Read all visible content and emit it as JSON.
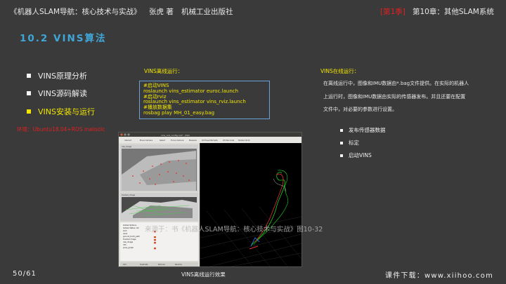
{
  "header": {
    "book_title": "《机器人SLAM导航：核心技术与实战》",
    "author": "张虎 著",
    "publisher": "机械工业出版社",
    "chapter_tag": "[第1季]",
    "chapter_title": "第10章：其他SLAM系统"
  },
  "section_title": "10.2 VINS算法",
  "left_list": [
    {
      "label": "VINS原理分析",
      "active": false
    },
    {
      "label": "VINS源码解读",
      "active": false
    },
    {
      "label": "VINS安装与运行",
      "active": true
    }
  ],
  "env_note": "环境：Ubuntu18.04+ROS melodic",
  "offline": {
    "title": "VINS离线运行：",
    "code_lines": [
      "#启动VINS",
      "roslaunch vins_estimator euroc.launch",
      "#启动rviz",
      "roslaunch vins_estimator vins_rviz.launch",
      "#播放数据集",
      "rosbag play MH_01_easy.bag"
    ],
    "caption": "VINS离线运行效果"
  },
  "online": {
    "title": "VINS在线运行：",
    "description": [
      "在离线运行中，图像和IMU数据由*.bag文件提供。在实际的机器人",
      "上运行时，图像和IMU数据由实际的传感器发布。并且还要在配置",
      "文件中，对必要的参数进行设置。"
    ],
    "items": [
      "发布传感器数据",
      "标定",
      "启动VINS"
    ]
  },
  "screenshot": {
    "window_title": "vins_rviz_config.rviz* - RViz",
    "toolbar": [
      "Interact",
      "Move Camera",
      "Select",
      "Focus Camera",
      "Measure",
      "2D Pose Estimate",
      "2D Nav Goal",
      "Publish Point"
    ],
    "image_panel_title": "raw_image",
    "match_panel_title": "tracked_image",
    "tree_items": [
      "Global Options",
      "Global Status: Ok",
      "Grid",
      "Axes",
      "ground_truth_path",
      "tracked image",
      "raw_image",
      "VIO",
      "pose_graph"
    ],
    "bottom_buttons": [
      "Add",
      "Duplicate",
      "Remove",
      "Rename"
    ]
  },
  "watermark": "来源于：书《机器人SLAM导航：核心技术与实战》图10-32",
  "footer": {
    "page": "50/61",
    "download": "课件下载：www.xiihoo.com"
  },
  "colors": {
    "background": "#3a3a3a",
    "section_blue": "#3fa6d8",
    "highlight_yellow": "#f3e600",
    "alert_red": "#e02020"
  }
}
